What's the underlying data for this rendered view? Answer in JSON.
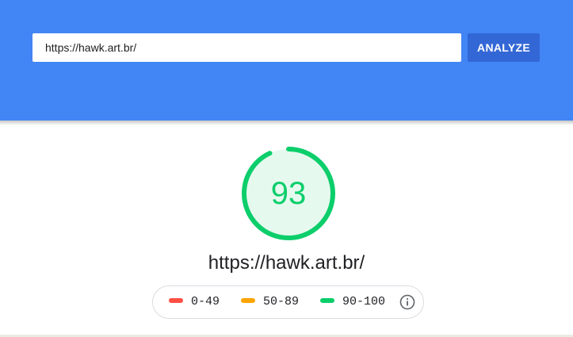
{
  "search": {
    "url_value": "https://hawk.art.br/",
    "analyze_label": "ANALYZE"
  },
  "result": {
    "score": 93,
    "score_text": "93",
    "score_color": "#0cce6b",
    "page_url": "https://hawk.art.br/"
  },
  "legend": {
    "items": [
      {
        "label": "0-49",
        "color": "#ff4e42"
      },
      {
        "label": "50-89",
        "color": "#ffa400"
      },
      {
        "label": "90-100",
        "color": "#0cce6b"
      }
    ],
    "info_icon": "info-icon"
  },
  "colors": {
    "header": "#4285f4",
    "button": "#3367d6"
  }
}
